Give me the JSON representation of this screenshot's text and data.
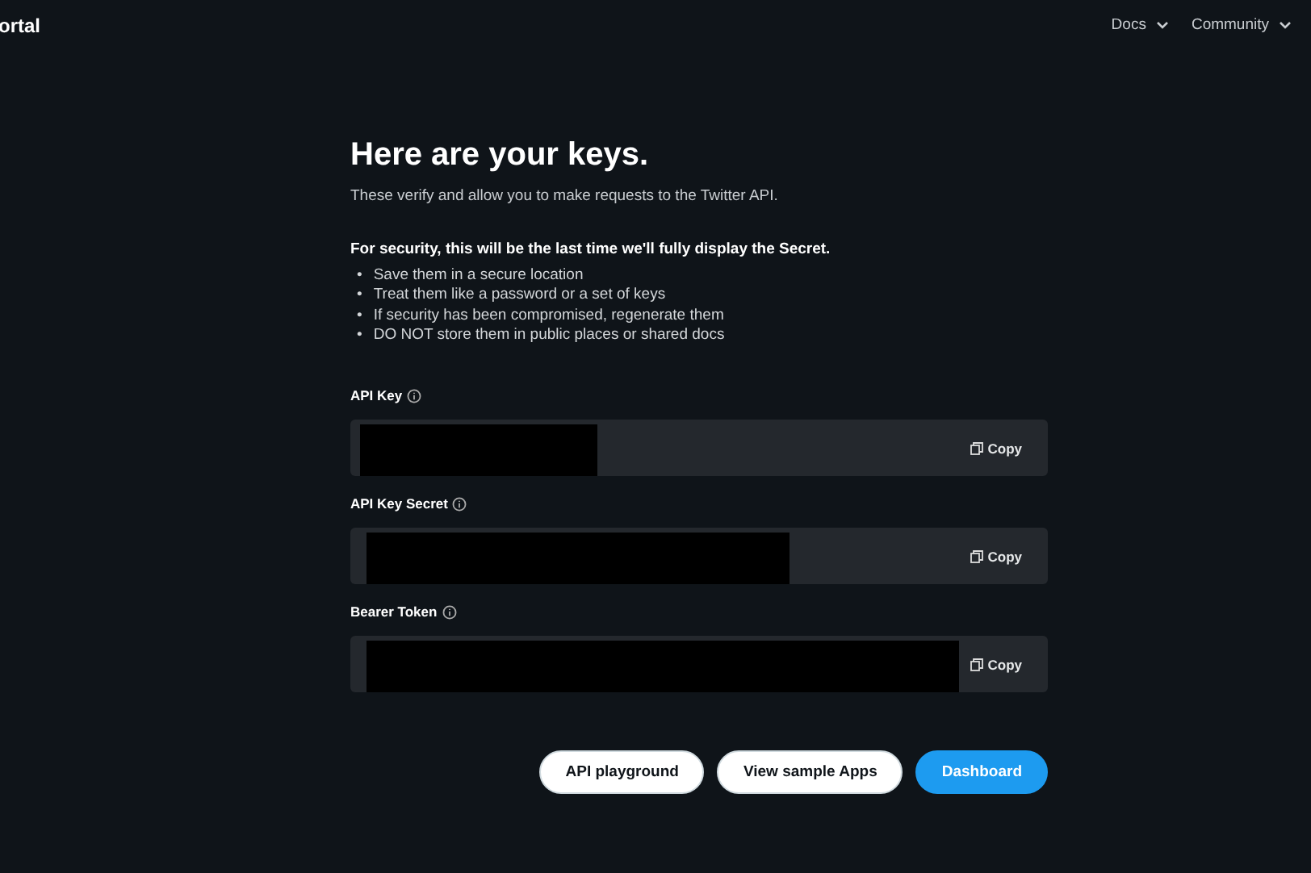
{
  "header": {
    "brand": "ortal",
    "nav": [
      {
        "label": "Docs"
      },
      {
        "label": "Community"
      }
    ]
  },
  "title": "Here are your keys.",
  "subtitle": "These verify and allow you to make requests to the Twitter API.",
  "warning": "For security, this will be the last time we'll fully display the Secret.",
  "tips": [
    {
      "bullet": "•",
      "text": "Save them in a secure location"
    },
    {
      "bullet": "•",
      "text": "Treat them like a password or a set of keys"
    },
    {
      "bullet": "•",
      "text": "If security has been compromised, regenerate them"
    },
    {
      "bullet": "•",
      "text": "DO NOT store them in public places or shared docs"
    }
  ],
  "keys": [
    {
      "label": "API Key",
      "copy": "Copy"
    },
    {
      "label": "API Key Secret",
      "copy": "Copy"
    },
    {
      "label": "Bearer Token",
      "copy": "Copy"
    }
  ],
  "buttons": [
    {
      "label": "API playground",
      "kind": "secondary"
    },
    {
      "label": "View sample Apps",
      "kind": "secondary"
    },
    {
      "label": "Dashboard",
      "kind": "primary"
    }
  ]
}
